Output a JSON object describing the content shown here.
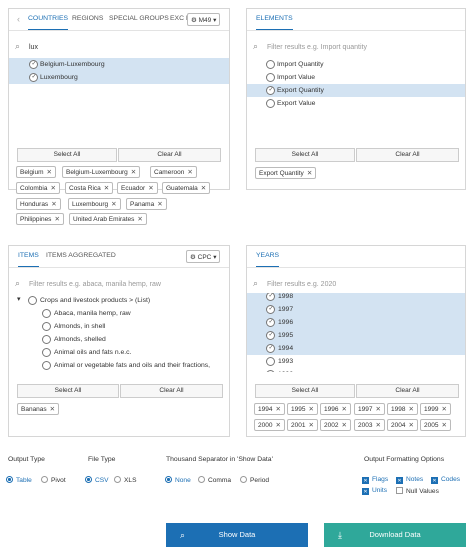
{
  "countries_panel": {
    "tabs": [
      "COUNTRIES",
      "REGIONS",
      "SPECIAL GROUPS",
      "EXC I"
    ],
    "code_button": "M49",
    "search_value": "lux",
    "results": [
      "Belgium-Luxembourg",
      "Luxembourg"
    ],
    "select_all": "Select All",
    "clear_all": "Clear All",
    "chips": [
      "Belgium",
      "Belgium-Luxembourg",
      "Cameroon",
      "Colombia",
      "Costa Rica",
      "Ecuador",
      "Guatemala",
      "Honduras",
      "Luxembourg",
      "Panama",
      "Philippines",
      "United Arab Emirates"
    ]
  },
  "elements_panel": {
    "tab": "ELEMENTS",
    "search_placeholder": "Filter results  e.g. Import quantity",
    "items": [
      "Import Quantity",
      "Import Value",
      "Export Quantity",
      "Export Value"
    ],
    "select_all": "Select All",
    "clear_all": "Clear All",
    "chips": [
      "Export Quantity"
    ]
  },
  "items_panel": {
    "tabs": [
      "ITEMS",
      "ITEMS AGGREGATED"
    ],
    "code_button": "CPC",
    "search_placeholder": "Filter results  e.g. abaca, manila hemp, raw",
    "group": "Crops and livestock products > (List)",
    "items": [
      "Abaca, manila hemp, raw",
      "Almonds, in shell",
      "Almonds, shelled",
      "Animal oils and fats n.e.c.",
      "Animal or vegetable fats and oils and their fractions,"
    ],
    "select_all": "Select All",
    "clear_all": "Clear All",
    "chips": [
      "Bananas"
    ]
  },
  "years_panel": {
    "tab": "YEARS",
    "search_placeholder": "Filter results  e.g. 2020",
    "years": [
      "1998",
      "1997",
      "1996",
      "1995",
      "1994",
      "1993",
      "1992"
    ],
    "select_all": "Select All",
    "clear_all": "Clear All",
    "chips": [
      "1994",
      "1995",
      "1996",
      "1997",
      "1998",
      "1999",
      "2000",
      "2001",
      "2002",
      "2003",
      "2004",
      "2005"
    ]
  },
  "output": {
    "output_type_label": "Output Type",
    "output_types": [
      "Table",
      "Pivot"
    ],
    "file_type_label": "File Type",
    "file_types": [
      "CSV",
      "XLS"
    ],
    "separator_label": "Thousand Separator in 'Show Data'",
    "separators": [
      "None",
      "Comma",
      "Period"
    ],
    "formatting_label": "Output Formatting Options",
    "formatting": [
      "Flags",
      "Notes",
      "Codes",
      "Units",
      "Null Values"
    ]
  },
  "buttons": {
    "show_data": "Show Data",
    "download_data": "Download Data"
  },
  "colors": {
    "accent": "#1c6fb4",
    "selected_row": "#d3e3f2",
    "download": "#2fa89a"
  }
}
